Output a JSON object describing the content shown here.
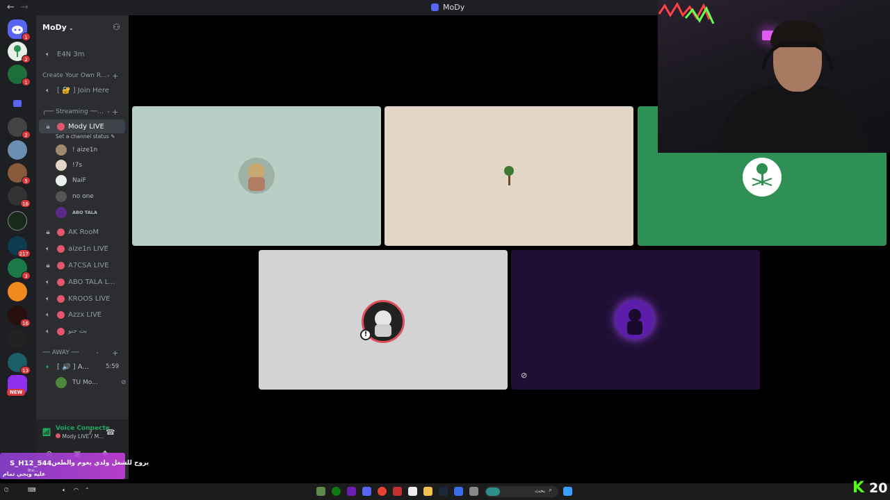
{
  "window": {
    "title": "MoDy"
  },
  "server": {
    "name": "MoDy"
  },
  "rail_badges": [
    "1",
    "2",
    "1",
    "2",
    "5",
    "16",
    "217",
    "3",
    "16",
    "13"
  ],
  "rail_new": "NEW",
  "channels": {
    "top_partial": "E4N 3m",
    "cat1": "Create Your Own R...",
    "join": "[ 🔐 ] Join Here",
    "cat2": "┌── Streaming ──...",
    "active": "Mody LIVE",
    "status_hint": "Set a channel status",
    "users": [
      "! aize1n",
      "!7s",
      "NaiF",
      "no one",
      "ABO TALA"
    ],
    "list": [
      "AK RooM",
      "aize1n LIVE",
      "A7CSA LIVE",
      "ABO TALA L...",
      "KROOS LIVE",
      "Azzx LIVE",
      "بث جنو"
    ],
    "cat3": "── AWAY ──",
    "away_channel": "[ 🔊 ] A...",
    "away_time": "5:59",
    "away_user": "TU Mo..."
  },
  "voice": {
    "title": "Voice Connecte",
    "subtitle": "Mody LIVE / M..."
  },
  "overlay": {
    "code": "S_H12_544",
    "line1": "بروح للشغل ولدي يعوم والطعن",
    "line2": "عليه ويجي تمام",
    "sub": "Inv..."
  },
  "taskbar": {
    "search": "بحث",
    "kick_number": "20"
  },
  "colors": {
    "tile1": "#b8cfc5",
    "tile2": "#e3d6c7",
    "tile3": "#2e9054",
    "tile4": "#d3d3d3",
    "tile5": "#200f35",
    "live_dot": "#e0566d",
    "voice_green": "#23a55a"
  }
}
